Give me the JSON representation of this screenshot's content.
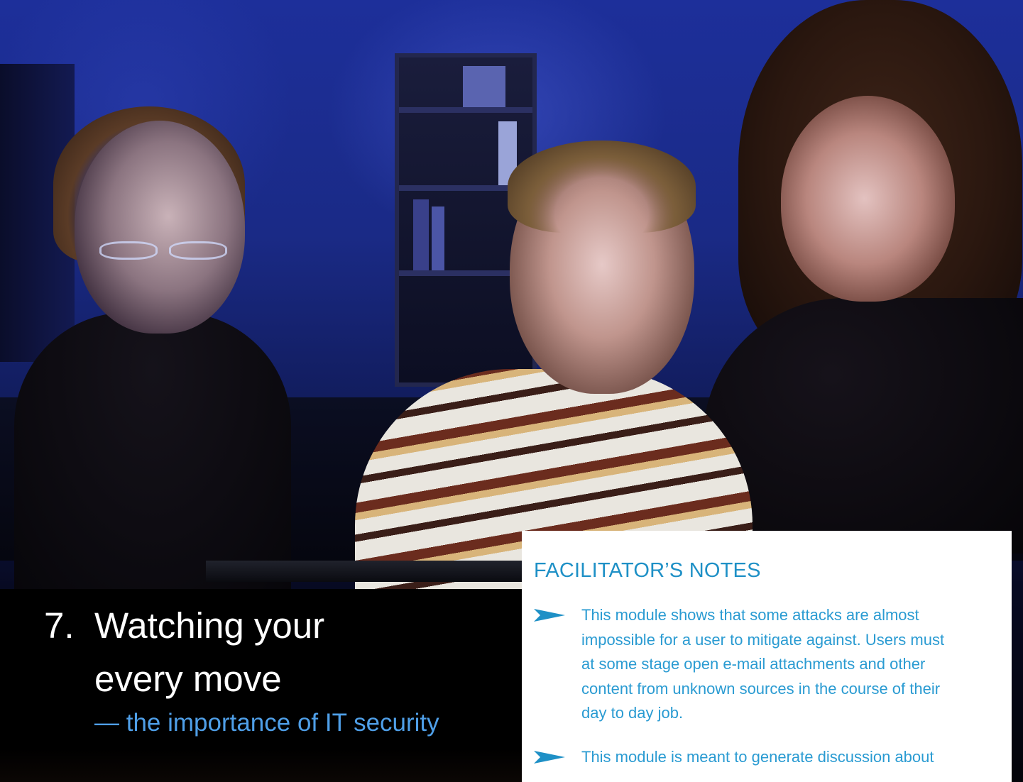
{
  "title": {
    "number": "7.",
    "line1": "Watching your",
    "line2": "every move",
    "subtitle": "— the importance of IT security"
  },
  "facilitator_notes": {
    "heading": "FACILITATOR’S NOTES",
    "bullet_icon": "chevron-arrow-icon",
    "items": [
      {
        "lines": [
          "This module shows that some attacks are almost",
          "impossible for a user to mitigate against. Users must",
          "at some stage open e-mail attachments and other",
          "content from unknown sources in the course of their",
          "day to day job."
        ]
      },
      {
        "lines": [
          "This module is meant to generate discussion about"
        ]
      }
    ]
  },
  "colors": {
    "accent_blue": "#1e90c6",
    "note_text_blue": "#2a9bd2",
    "subtitle_blue": "#4f9fe8",
    "title_band": "#000000",
    "panel_bg": "#ffffff"
  }
}
